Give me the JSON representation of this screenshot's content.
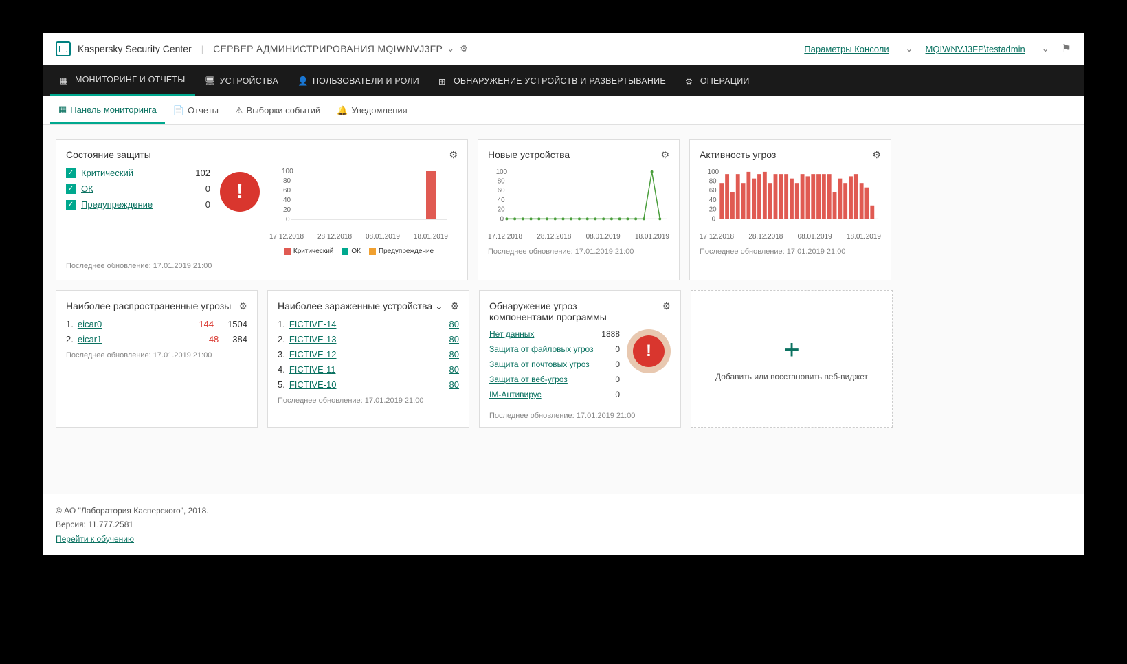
{
  "header": {
    "brand": "Kaspersky Security Center",
    "server_label": "СЕРВЕР АДМИНИСТРИРОВАНИЯ MQIWNVJ3FP",
    "console_params": "Параметры Консоли",
    "user": "MQIWNVJ3FP\\testadmin"
  },
  "nav": {
    "items": [
      {
        "label": "МОНИТОРИНГ И ОТЧЕТЫ",
        "active": true
      },
      {
        "label": "УСТРОЙСТВА"
      },
      {
        "label": "ПОЛЬЗОВАТЕЛИ И РОЛИ"
      },
      {
        "label": "ОБНАРУЖЕНИЕ УСТРОЙСТВ И РАЗВЕРТЫВАНИЕ"
      },
      {
        "label": "ОПЕРАЦИИ"
      }
    ]
  },
  "subnav": {
    "items": [
      {
        "label": "Панель мониторинга",
        "active": true
      },
      {
        "label": "Отчеты"
      },
      {
        "label": "Выборки событий"
      },
      {
        "label": "Уведомления"
      }
    ]
  },
  "widgets": {
    "protection": {
      "title": "Состояние защиты",
      "rows": [
        {
          "label": "Критический",
          "value": "102"
        },
        {
          "label": "ОК",
          "value": "0"
        },
        {
          "label": "Предупреждение",
          "value": "0"
        }
      ],
      "updated": "Последнее обновление: 17.01.2019 21:00"
    },
    "new_devices": {
      "title": "Новые устройства",
      "updated": "Последнее обновление: 17.01.2019 21:00"
    },
    "threat_activity": {
      "title": "Активность угроз",
      "updated": "Последнее обновление: 17.01.2019 21:00"
    },
    "common_threats": {
      "title": "Наиболее распространенные угрозы",
      "rows": [
        {
          "idx": "1.",
          "name": "eicar0",
          "v1": "144",
          "v2": "1504"
        },
        {
          "idx": "2.",
          "name": "eicar1",
          "v1": "48",
          "v2": "384"
        }
      ],
      "updated": "Последнее обновление: 17.01.2019 21:00"
    },
    "infected": {
      "title": "Наиболее зараженные устройства",
      "rows": [
        {
          "idx": "1.",
          "name": "FICTIVE-14",
          "v": "80"
        },
        {
          "idx": "2.",
          "name": "FICTIVE-13",
          "v": "80"
        },
        {
          "idx": "3.",
          "name": "FICTIVE-12",
          "v": "80"
        },
        {
          "idx": "4.",
          "name": "FICTIVE-11",
          "v": "80"
        },
        {
          "idx": "5.",
          "name": "FICTIVE-10",
          "v": "80"
        }
      ],
      "updated": "Последнее обновление: 17.01.2019 21:00"
    },
    "detection": {
      "title": "Обнаружение угроз компонентами программы",
      "rows": [
        {
          "label": "Нет данных",
          "value": "1888"
        },
        {
          "label": "Защита от файловых угроз",
          "value": "0"
        },
        {
          "label": "Защита от почтовых угроз",
          "value": "0"
        },
        {
          "label": "Защита от веб-угроз",
          "value": "0"
        },
        {
          "label": "IM-Антивирус",
          "value": "0"
        }
      ],
      "updated": "Последнее обновление: 17.01.2019 21:00"
    },
    "add": {
      "label": "Добавить или восстановить веб-виджет"
    }
  },
  "legend": {
    "critical": "Критический",
    "ok": "ОК",
    "warn": "Предупреждение"
  },
  "x_dates": [
    "17.12.2018",
    "28.12.2018",
    "08.01.2019",
    "18.01.2019"
  ],
  "footer": {
    "copyright": "© АО \"Лаборатория Касперского\", 2018.",
    "version": "Версия: 11.777.2581",
    "training": "Перейти к обучению"
  },
  "chart_data": [
    {
      "type": "bar",
      "title": "Состояние защиты",
      "categories": [
        "17.12.2018",
        "28.12.2018",
        "08.01.2019",
        "18.01.2019"
      ],
      "series": [
        {
          "name": "Критический",
          "values": [
            0,
            0,
            0,
            102
          ]
        },
        {
          "name": "ОК",
          "values": [
            0,
            0,
            0,
            0
          ]
        },
        {
          "name": "Предупреждение",
          "values": [
            0,
            0,
            0,
            0
          ]
        }
      ],
      "ylim": [
        0,
        100
      ],
      "yticks": [
        0,
        20,
        40,
        60,
        80,
        100
      ]
    },
    {
      "type": "line",
      "title": "Новые устройства",
      "x": [
        "17.12.2018",
        "28.12.2018",
        "08.01.2019",
        "18.01.2019"
      ],
      "values": [
        0,
        0,
        0,
        0,
        0,
        0,
        0,
        0,
        0,
        0,
        0,
        0,
        0,
        0,
        0,
        0,
        0,
        0,
        0,
        0,
        0,
        0,
        0,
        0,
        0,
        0,
        0,
        0,
        0,
        0,
        102,
        0
      ],
      "ylim": [
        0,
        100
      ],
      "yticks": [
        0,
        20,
        40,
        60,
        80,
        100
      ]
    },
    {
      "type": "bar",
      "title": "Активность угроз",
      "x": [
        "17.12.2018",
        "28.12.2018",
        "08.01.2019",
        "18.01.2019"
      ],
      "values": [
        80,
        100,
        60,
        100,
        80,
        105,
        90,
        100,
        105,
        80,
        100,
        100,
        100,
        90,
        80,
        100,
        95,
        100,
        100,
        100,
        100,
        60,
        90,
        80,
        95,
        100,
        80,
        70,
        30
      ],
      "ylim": [
        0,
        100
      ],
      "yticks": [
        0,
        20,
        40,
        60,
        80,
        100
      ]
    }
  ]
}
